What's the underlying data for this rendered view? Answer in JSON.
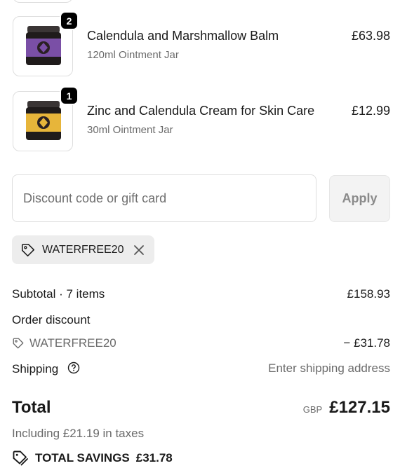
{
  "line_items": [
    {
      "quantity": "2",
      "name": "Calendula and Marshmallow Balm",
      "variant": "120ml Ointment Jar",
      "price": "£63.98",
      "label_color": "#7a4fa6"
    },
    {
      "quantity": "1",
      "name": "Zinc and Calendula Cream for Skin Care",
      "variant": "30ml Ointment Jar",
      "price": "£12.99",
      "label_color": "#e7b53a"
    }
  ],
  "discount": {
    "placeholder": "Discount code or gift card",
    "apply_label": "Apply",
    "applied_code": "WATERFREE20"
  },
  "summary": {
    "subtotal_label": "Subtotal · 7 items",
    "subtotal_value": "£158.93",
    "order_discount_label": "Order discount",
    "discount_code": "WATERFREE20",
    "discount_value": "− £31.78",
    "shipping_label": "Shipping",
    "shipping_value": "Enter shipping address",
    "total_label": "Total",
    "currency": "GBP",
    "total_value": "£127.15",
    "taxes_note": "Including £21.19 in taxes",
    "savings_label": "TOTAL SAVINGS",
    "savings_value": "£31.78"
  }
}
